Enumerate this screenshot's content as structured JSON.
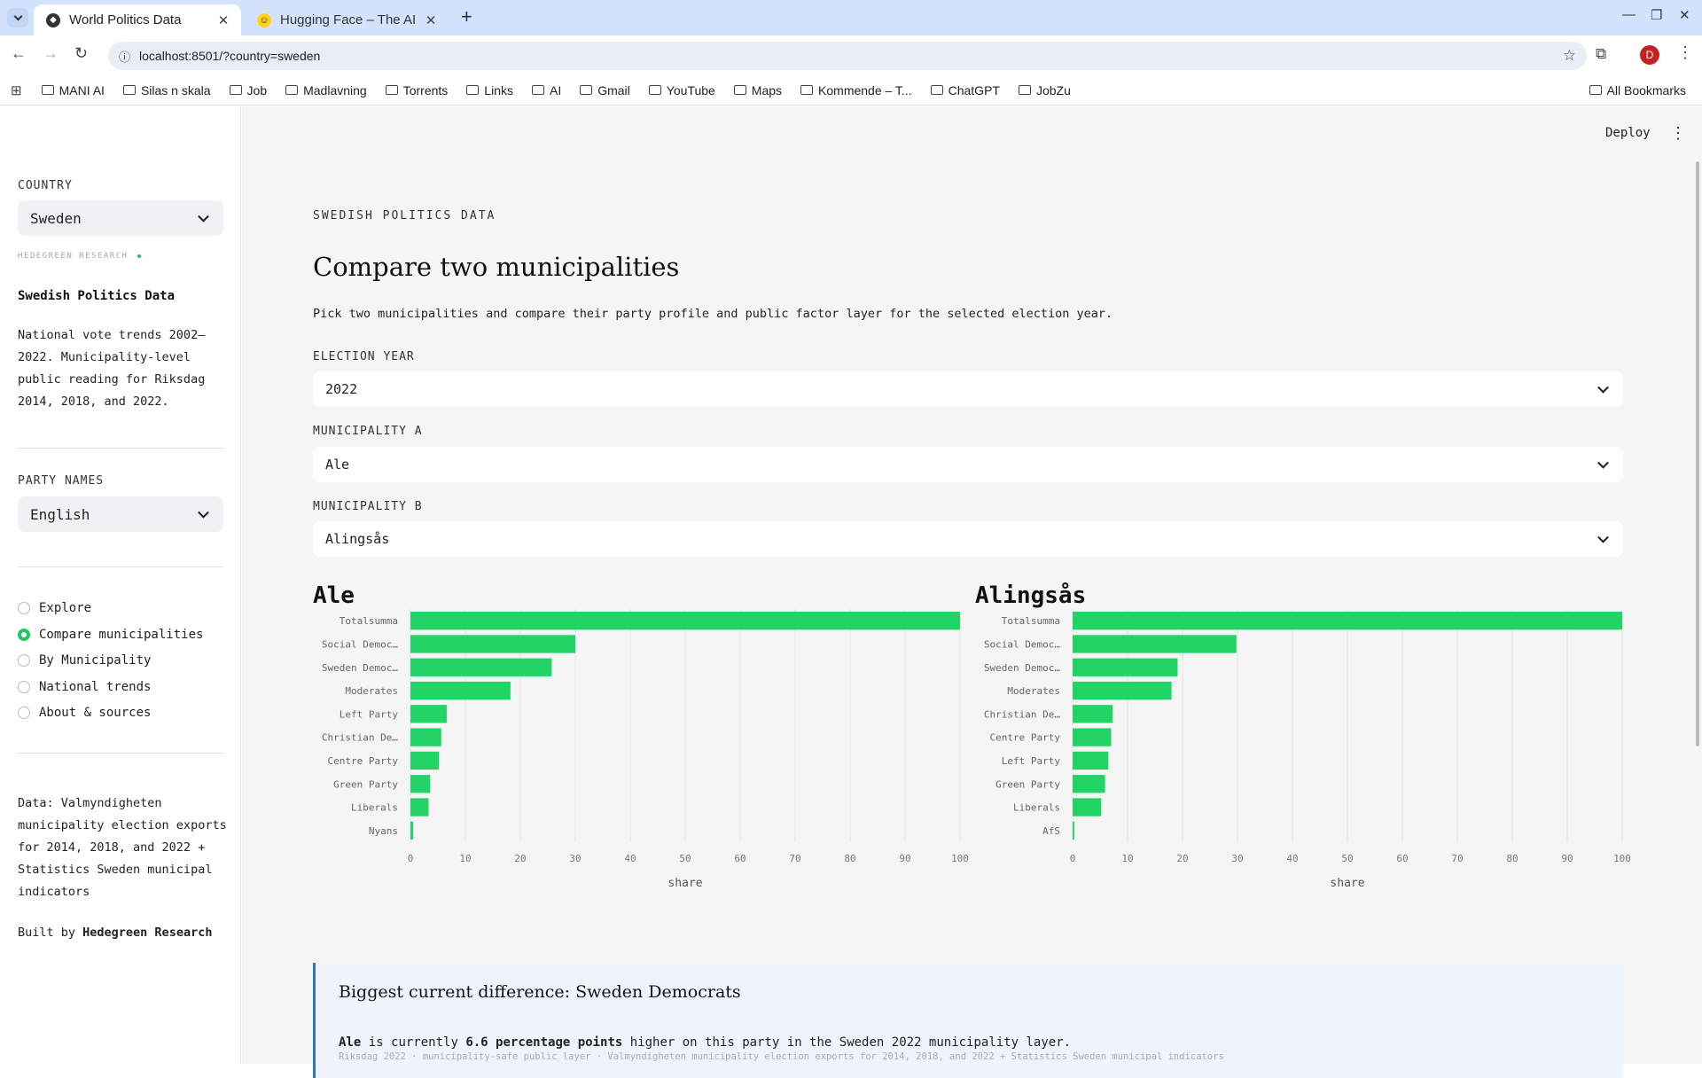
{
  "browser": {
    "tabs": [
      {
        "title": "World Politics Data",
        "active": true
      },
      {
        "title": "Hugging Face – The AI community building the future.",
        "active": false
      }
    ],
    "url": "localhost:8501/?country=sweden",
    "profile_initial": "D",
    "bookmarks": [
      "MANI AI",
      "Silas n skala",
      "Job",
      "Madlavning",
      "Torrents",
      "Links",
      "AI",
      "Gmail",
      "YouTube",
      "Maps",
      "Kommende – T...",
      "ChatGPT",
      "JobZu"
    ],
    "all_bookmarks": "All Bookmarks"
  },
  "header": {
    "deploy": "Deploy"
  },
  "sidebar": {
    "country_label": "COUNTRY",
    "country_value": "Sweden",
    "brand": "HEDEGREEN RESEARCH",
    "app_title": "Swedish Politics Data",
    "description": "National vote trends 2002–2022. Municipality-level public reading for Riksdag 2014, 2018, and 2022.",
    "party_names_label": "PARTY NAMES",
    "party_names_value": "English",
    "nav": [
      "Explore",
      "Compare municipalities",
      "By Municipality",
      "National trends",
      "About & sources"
    ],
    "nav_selected": 1,
    "data_note": "Data: Valmyndigheten municipality election exports for 2014, 2018, and 2022 + Statistics Sweden municipal indicators",
    "built_prefix": "Built by ",
    "built_by": "Hedegreen Research"
  },
  "main": {
    "eyebrow": "SWEDISH POLITICS DATA",
    "title": "Compare two municipalities",
    "subtitle": "Pick two municipalities and compare their party profile and public factor layer for the selected election year.",
    "year_label": "ELECTION YEAR",
    "year_value": "2022",
    "muni_a_label": "MUNICIPALITY A",
    "muni_a_value": "Ale",
    "muni_b_label": "MUNICIPALITY B",
    "muni_b_value": "Alingsås",
    "callout": {
      "title": "Biggest current difference: Sweden Democrats",
      "muni": "Ale",
      "t1": " is currently ",
      "diff": "6.6 percentage points",
      "t2": " higher on this party in the Sweden 2022 municipality layer.",
      "footer": "Riksdag 2022 · municipality-safe public layer · Valmyndigheten municipality election exports for 2014, 2018, and 2022 + Statistics Sweden municipal indicators"
    }
  },
  "colors": {
    "accent": "#22d365",
    "radio": "#22c55e"
  },
  "chart_data": [
    {
      "type": "bar",
      "title": "Ale",
      "xlabel": "share",
      "xlim": [
        0,
        100
      ],
      "ticks": [
        0,
        10,
        20,
        30,
        40,
        50,
        60,
        70,
        80,
        90,
        100
      ],
      "categories": [
        "Totalsumma",
        "Social Democ…",
        "Sweden Democ…",
        "Moderates",
        "Left Party",
        "Christian De…",
        "Centre Party",
        "Green Party",
        "Liberals",
        "Nyans"
      ],
      "values": [
        100,
        30,
        25.7,
        18.2,
        6.6,
        5.6,
        5.2,
        3.6,
        3.3,
        0.5
      ]
    },
    {
      "type": "bar",
      "title": "Alingsås",
      "xlabel": "share",
      "xlim": [
        0,
        100
      ],
      "ticks": [
        0,
        10,
        20,
        30,
        40,
        50,
        60,
        70,
        80,
        90,
        100
      ],
      "categories": [
        "Totalsumma",
        "Social Democ…",
        "Sweden Democ…",
        "Moderates",
        "Christian De…",
        "Centre Party",
        "Left Party",
        "Green Party",
        "Liberals",
        "AfS"
      ],
      "values": [
        100,
        29.8,
        19.1,
        18,
        7.3,
        7,
        6.5,
        5.9,
        5.2,
        0.3
      ]
    }
  ]
}
